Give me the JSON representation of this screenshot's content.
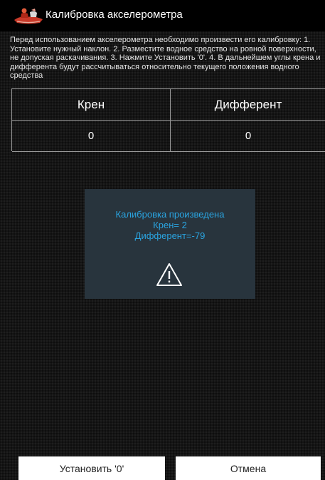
{
  "titlebar": {
    "title": "Калибровка акселерометра",
    "icon": "accelerometer-app-icon"
  },
  "description": "Перед использованием акселерометра необходимо произвести его калибровку: 1. Установите нужный наклон. 2. Разместите водное средство на ровной поверхности, не допуская раскачивания. 3. Нажмите Установить '0'. 4. В дальнейшем углы крена и дифферента будут рассчитываться относительно текущего положения водного средства",
  "table": {
    "headers": [
      "Крен",
      "Дифферент"
    ],
    "values": [
      "0",
      "0"
    ]
  },
  "dialog": {
    "line1": "Калибровка произведена",
    "line2": "Крен= 2",
    "line3": "Дифферент=-79",
    "icon": "warning-icon",
    "text_color": "#2aa4e0",
    "background": "#28343d"
  },
  "buttons": {
    "set_zero": "Установить '0'",
    "cancel": "Отмена"
  }
}
